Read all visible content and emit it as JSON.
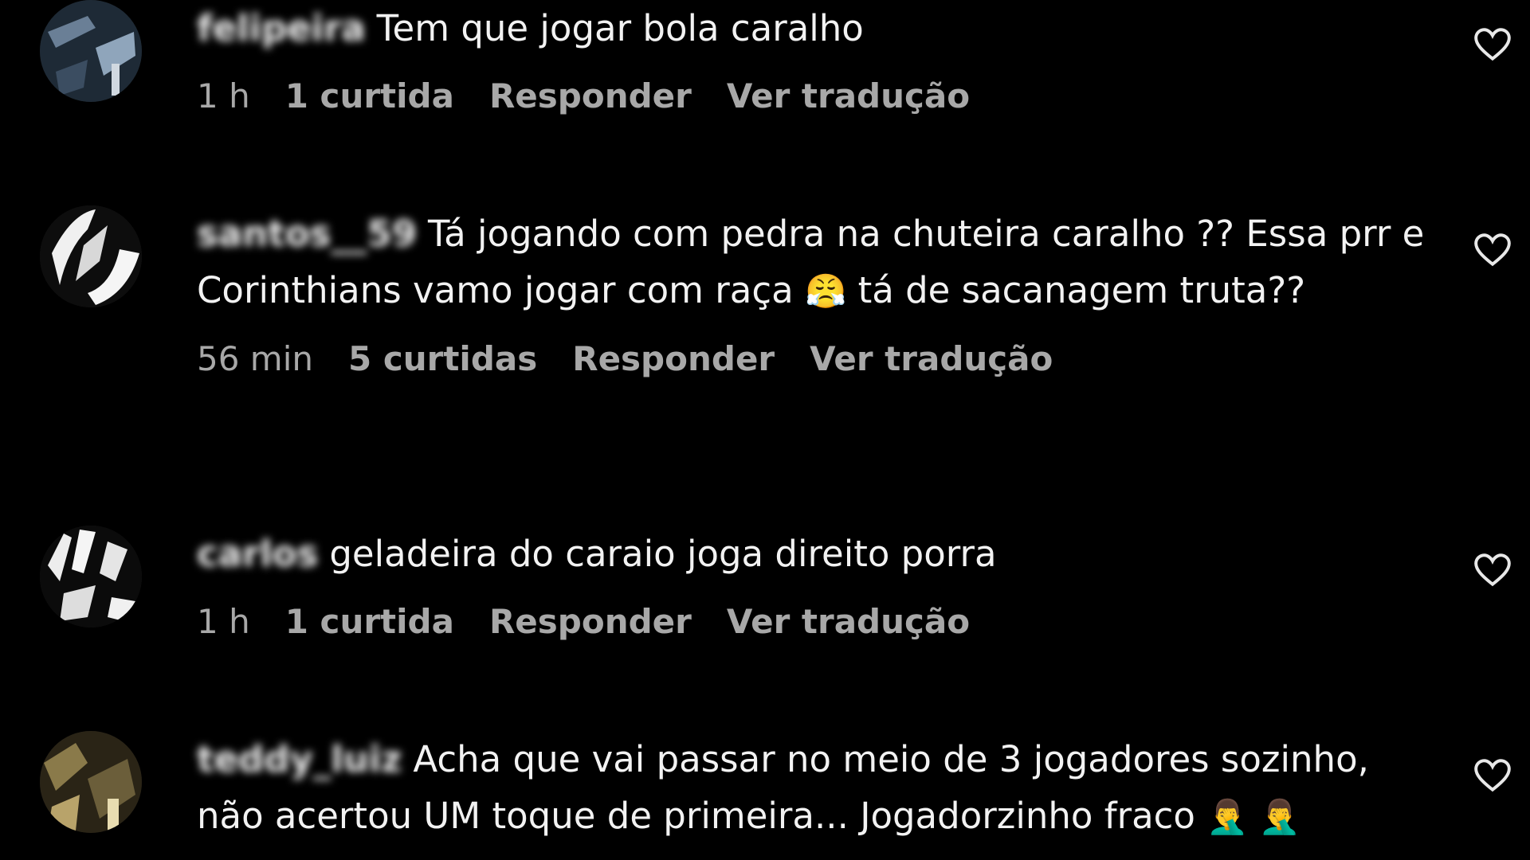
{
  "comments": [
    {
      "username": "felipeira",
      "text": "Tem que jogar bola caralho",
      "time": "1 h",
      "likes": "1 curtida",
      "reply_label": "Responder",
      "translate_label": "Ver tradução",
      "avatar_color": "#2b3a4a"
    },
    {
      "username": "santos__59",
      "text_part1": "Tá jogando com pedra na chuteira caralho ?? Essa prr e Corinthians vamo jogar com raça",
      "emoji": "😤",
      "text_part2": "tá de sacanagem truta??",
      "time": "56 min",
      "likes": "5 curtidas",
      "reply_label": "Responder",
      "translate_label": "Ver tradução",
      "avatar_color": "#ffffff"
    },
    {
      "username": "carlos",
      "text": "geladeira do caraio joga direito porra",
      "time": "1 h",
      "likes": "1 curtida",
      "reply_label": "Responder",
      "translate_label": "Ver tradução",
      "avatar_color": "#ffffff"
    },
    {
      "username": "teddy_luiz",
      "text": "Acha que vai passar no meio de 3 jogadores sozinho, não acertou UM toque de primeira... Jogadorzinho fraco",
      "emojis": "🤦‍♂️ 🤦‍♂️",
      "avatar_color": "#5a4a2a"
    }
  ],
  "icons": {
    "like": "heart-outline-icon"
  }
}
